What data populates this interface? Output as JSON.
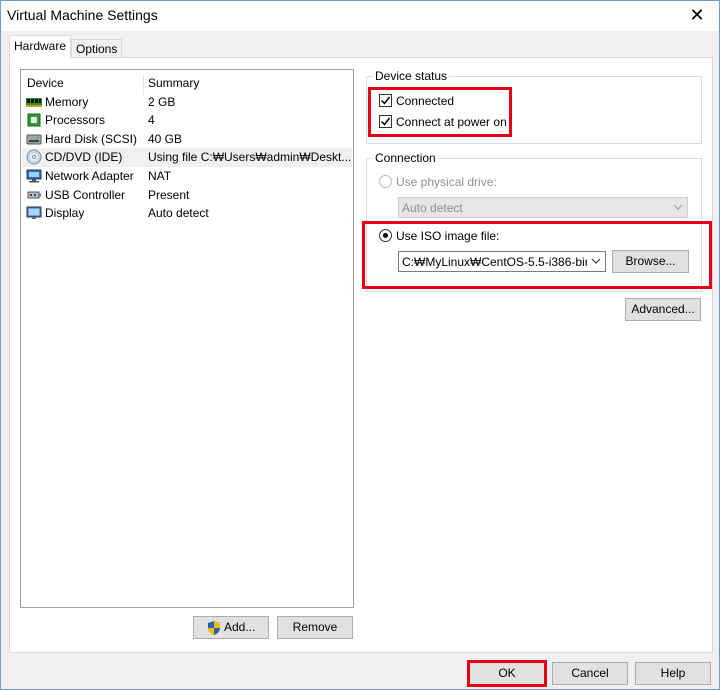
{
  "window": {
    "title": "Virtual Machine Settings",
    "close_glyph": "✕"
  },
  "tabs": [
    {
      "label": "Hardware",
      "active": true
    },
    {
      "label": "Options",
      "active": false
    }
  ],
  "device_list": {
    "columns": {
      "device": "Device",
      "summary": "Summary"
    },
    "rows": [
      {
        "name": "Memory",
        "summary": "2 GB",
        "icon": "memory-icon"
      },
      {
        "name": "Processors",
        "summary": "4",
        "icon": "processor-icon"
      },
      {
        "name": "Hard Disk (SCSI)",
        "summary": "40 GB",
        "icon": "hard-disk-icon"
      },
      {
        "name": "CD/DVD (IDE)",
        "summary": "Using file C:₩Users₩admin₩Deskt...",
        "icon": "cd-dvd-icon",
        "selected": true
      },
      {
        "name": "Network Adapter",
        "summary": "NAT",
        "icon": "network-adapter-icon"
      },
      {
        "name": "USB Controller",
        "summary": "Present",
        "icon": "usb-icon"
      },
      {
        "name": "Display",
        "summary": "Auto detect",
        "icon": "display-icon"
      }
    ]
  },
  "buttons": {
    "add": "Add...",
    "remove": "Remove",
    "ok": "OK",
    "cancel": "Cancel",
    "help": "Help",
    "browse": "Browse...",
    "advanced": "Advanced..."
  },
  "device_status": {
    "title": "Device status",
    "connected": {
      "label": "Connected",
      "checked": true
    },
    "connect_at_power_on": {
      "label": "Connect at power on",
      "checked": true
    }
  },
  "connection": {
    "title": "Connection",
    "physical_drive": {
      "label": "Use physical drive:",
      "selected": false,
      "enabled": false
    },
    "physical_drive_select": "Auto detect",
    "iso_image": {
      "label": "Use ISO image file:",
      "selected": true
    },
    "iso_path": "C:₩MyLinux₩CentOS-5.5-i386-bin-"
  },
  "colors": {
    "highlight": "#e60012",
    "accent": "#0078d7"
  }
}
